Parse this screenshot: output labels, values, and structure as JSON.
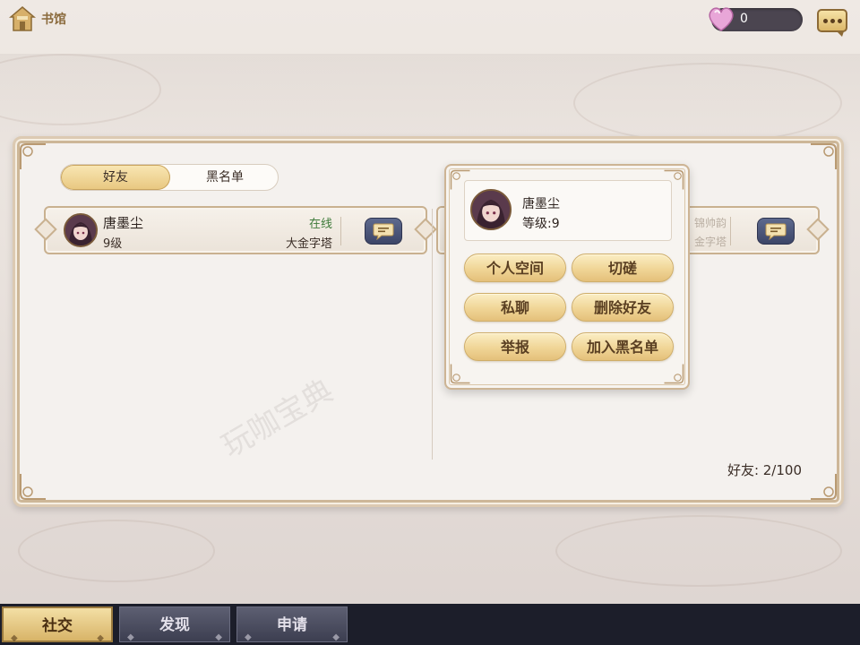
{
  "topbar": {
    "home_label": "书馆",
    "currency_value": "0"
  },
  "tabs": {
    "friends": "好友",
    "blacklist": "黑名单"
  },
  "friend": {
    "name": "唐墨尘",
    "level": "9级",
    "status": "在线",
    "location": "大金字塔"
  },
  "ghost_friend": {
    "line1": "锦帅韵",
    "line2": "金字塔"
  },
  "friend_count": "好友: 2/100",
  "popup": {
    "name": "唐墨尘",
    "level": "等级:9",
    "actions": {
      "personal_space": "个人空间",
      "spar": "切磋",
      "private_chat": "私聊",
      "delete_friend": "删除好友",
      "report": "举报",
      "add_blacklist": "加入黑名单"
    }
  },
  "bottom_nav": {
    "social": "社交",
    "discover": "发现",
    "apply": "申请"
  },
  "colors": {
    "accent_gold": "#e8c77f",
    "online_green": "#3e7a3a",
    "nav_dark": "#1c1e2a"
  },
  "icons": {
    "home": "house-icon",
    "currency": "heart-gem-icon",
    "menu": "chat-bubble-ellipsis-icon",
    "message": "speech-bubble-icon"
  }
}
